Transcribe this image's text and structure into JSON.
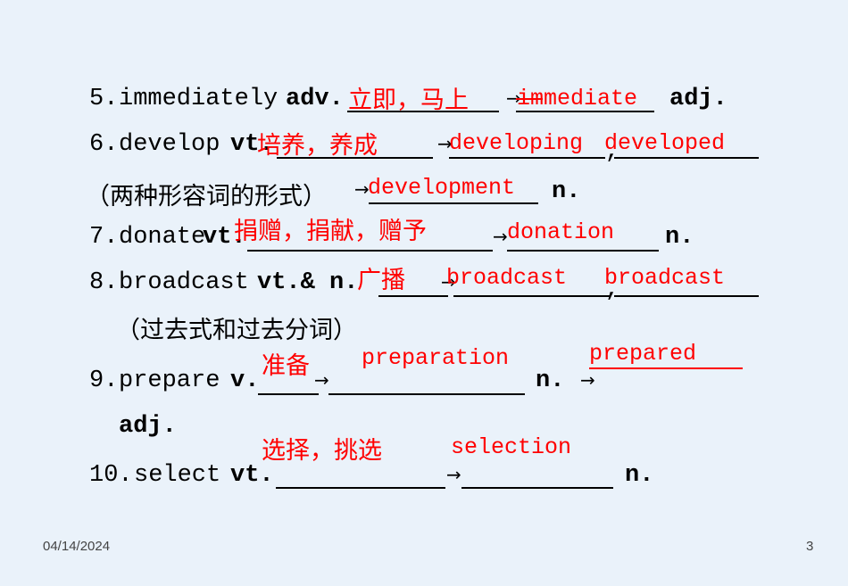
{
  "slide": {
    "background_color": "#eaf2fa",
    "items": [
      {
        "number": "5.",
        "word": "immediately",
        "pos1": "adv.",
        "answer_cn": "立即，马上",
        "answer_en": "immediate",
        "pos2": "adj."
      },
      {
        "number": "6.",
        "word": "develop",
        "pos1": "vt.",
        "answer_cn": "培养，养成",
        "answer_en1": "developing",
        "answer_en2": "developed",
        "note": "（两种形容词的形式）",
        "answer_en3": "development",
        "pos2": "n."
      },
      {
        "number": "7.",
        "word": "donate",
        "pos1": "vt.",
        "answer_cn": "捐赠，捐献，赠予",
        "answer_en": "donation",
        "pos2": "n."
      },
      {
        "number": "8.",
        "word": "broadcast",
        "pos1": "vt.& n.",
        "answer_cn": "广播",
        "answer_en1": "broadcast",
        "answer_en2": "broadcast",
        "note": "（过去式和过去分词）"
      },
      {
        "number": "9.",
        "word": "prepare",
        "pos1": "v.",
        "answer_cn": "准备",
        "answer_en1": "preparation",
        "pos2": "n.",
        "answer_en2": "prepared",
        "pos3": "adj."
      },
      {
        "number": "10.",
        "word": "select",
        "pos1": "vt.",
        "answer_cn": "选择，挑选",
        "answer_en": "selection",
        "pos2": "n."
      }
    ],
    "commas": {
      "c1": ",",
      "c2": ","
    },
    "arrows": {
      "a1": "→",
      "a2": "→",
      "a3": "→",
      "a4": "→",
      "a5": "→",
      "a6": "→",
      "a7": "→"
    }
  },
  "footer": {
    "date": "04/14/2024",
    "page": "3"
  }
}
